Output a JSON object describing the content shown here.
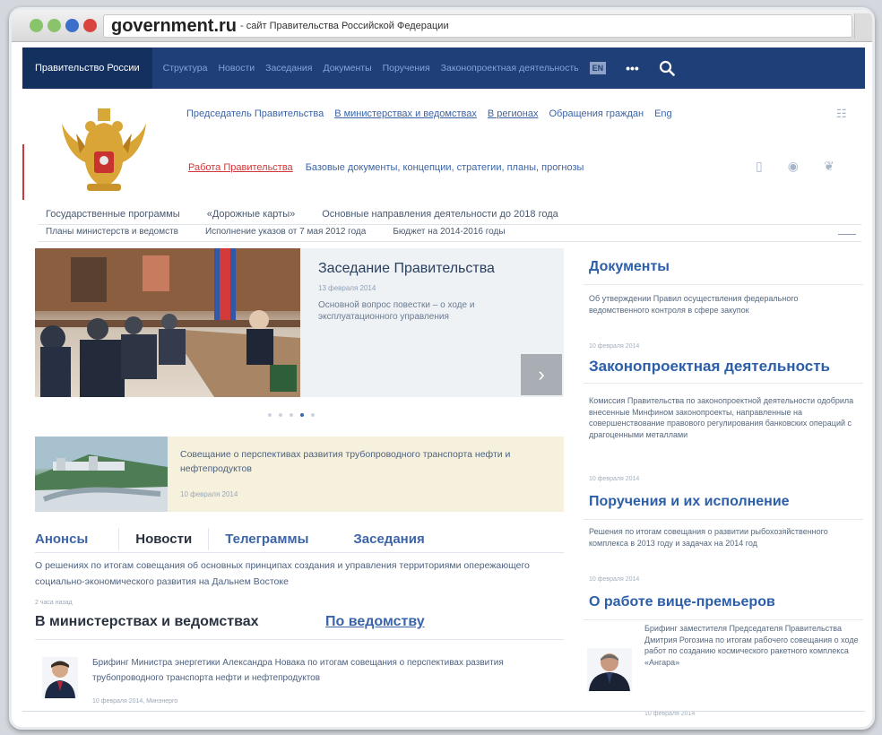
{
  "browser": {
    "domain": "government.ru",
    "title_rest": "- сайт Правительства Российской Федерации"
  },
  "topnav": {
    "home": "Правительство России",
    "items": [
      "Структура",
      "Новости",
      "Заседания",
      "Документы",
      "Поручения",
      "Законопроектная деятельность"
    ],
    "lang": "EN",
    "more": "•••"
  },
  "header": {
    "links": [
      "Председатель Правительства",
      "В министерствах и ведомствах",
      "В регионах",
      "Обращения граждан",
      "Eng"
    ],
    "work_active": "Работа Правительства",
    "work_rest": "Базовые документы, концепции, стратегии, планы, прогнозы"
  },
  "categories": {
    "row1": [
      "Государственные программы",
      "«Дорожные карты»",
      "Основные направления деятельности до 2018 года"
    ],
    "row2": [
      "Планы министерств и ведомств",
      "Исполнение указов от 7 мая 2012 года",
      "Бюджет на 2014-2016 годы"
    ]
  },
  "slider": {
    "title": "Заседание Правительства",
    "date": "13 февраля 2014",
    "desc": "Основной вопрос повестки – о  ходе и эксплуатационного управления"
  },
  "meeting": {
    "text": "Совещание о перспективах развития трубопроводного транспорта нефти и нефтепродуктов",
    "date": "10 февраля 2014"
  },
  "tabs": [
    "Анонсы",
    "Новости",
    "Телеграммы",
    "Заседания"
  ],
  "news": {
    "text": "О решениях по итогам совещания об основных принципах создания и управления территориями опережающего социально-экономического развития на Дальнем Востоке",
    "date": "2 часа назад"
  },
  "ministries": {
    "heading": "В министерствах и ведомствах",
    "link": "По ведомству",
    "text": "Брифинг Министра энергетики Александра Новака по итогам совещания о перспективах развития трубопроводного транспорта нефти и нефтепродуктов",
    "date": "10 февраля 2014, Минэнерго"
  },
  "right": {
    "docs": {
      "heading": "Документы",
      "text": "Об утверждении Правил осуществления федерального ведомственного контроля в сфере закупок",
      "date": "10 февраля 2014"
    },
    "law": {
      "heading": "Законопроектная деятельность",
      "text": "Комиссия Правительства по законопроектной деятельности одобрила внесенные Минфином законопроекты, направленные на совершенствование правового регулирования банковских операций с драгоценными металлами",
      "date": "10 февраля 2014"
    },
    "orders": {
      "heading": "Поручения и их исполнение",
      "text": "Решения по итогам совещания о развитии рыбохозяйственного комплекса в 2013 году и задачах на 2014 год",
      "date": "10 февраля 2014"
    },
    "vice": {
      "heading": "О работе вице-премьеров",
      "text": "Брифинг заместителя Председателя Правительства Дмитрия Рогозина по итогам рабочего совещания о ходе работ по созданию космического ракетного комплекса «Ангара»",
      "date": "10 февраля 2014"
    }
  },
  "colors": {
    "nav_bg": "#1f3f78",
    "link": "#3c64a8",
    "heading_blue": "#2c5fa8",
    "accent_red": "#d0373a",
    "card_bg": "#f6f1dc"
  }
}
